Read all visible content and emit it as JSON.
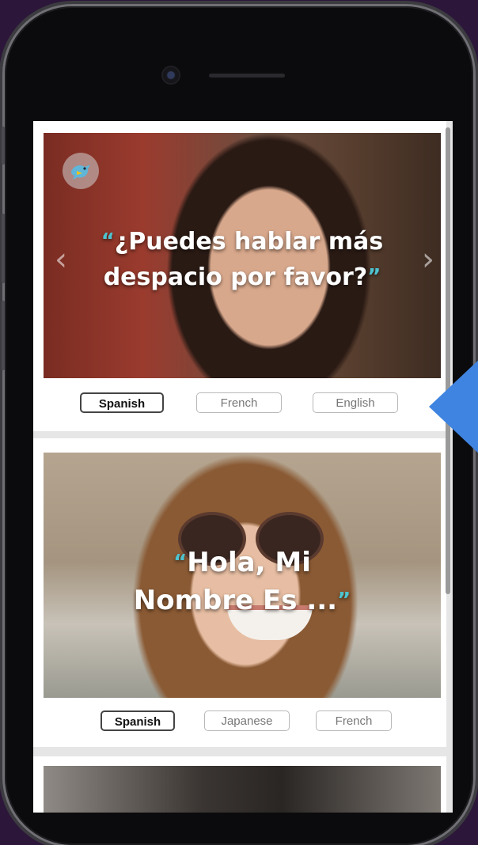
{
  "cards": [
    {
      "phrase_line1": "¿Puedes hablar más",
      "phrase_line2": "despacio por favor?",
      "languages": [
        "Spanish",
        "French",
        "English"
      ],
      "active": "Spanish"
    },
    {
      "phrase_line1": "Hola, Mi",
      "phrase_line2": "Nombre Es ...",
      "languages": [
        "Spanish",
        "Japanese",
        "French"
      ],
      "active": "Spanish"
    }
  ],
  "quote_open": "“",
  "quote_close": "”",
  "nav": {
    "prev": "‹",
    "next": "›"
  },
  "icons": {
    "logo": "bird-logo-icon",
    "prev": "chevron-left-icon",
    "next": "chevron-right-icon"
  },
  "colors": {
    "background": "#2c1639",
    "accent_quote": "#4dc3d0",
    "pointer": "#3f84e0",
    "bird": "#5fb6d9"
  }
}
